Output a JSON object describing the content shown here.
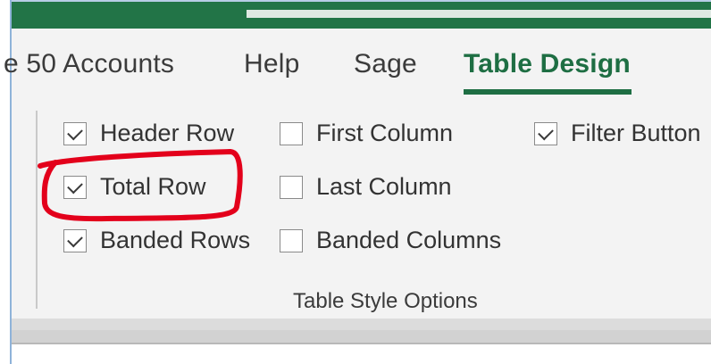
{
  "ribbon": {
    "tabs": [
      {
        "label": "e 50 Accounts",
        "active": false
      },
      {
        "label": "Help",
        "active": false
      },
      {
        "label": "Sage",
        "active": false
      },
      {
        "label": "Table Design",
        "active": true
      }
    ],
    "group": {
      "label": "Table Style Options",
      "options": [
        {
          "label": "Header Row",
          "checked": true
        },
        {
          "label": "Total Row",
          "checked": true
        },
        {
          "label": "Banded Rows",
          "checked": true
        },
        {
          "label": "First Column",
          "checked": false
        },
        {
          "label": "Last Column",
          "checked": false
        },
        {
          "label": "Banded Columns",
          "checked": false
        },
        {
          "label": "Filter Button",
          "checked": true
        }
      ]
    }
  },
  "colors": {
    "title_bar": "#227447",
    "active_tab": "#1e6e43",
    "annotation": "#e3001b"
  }
}
